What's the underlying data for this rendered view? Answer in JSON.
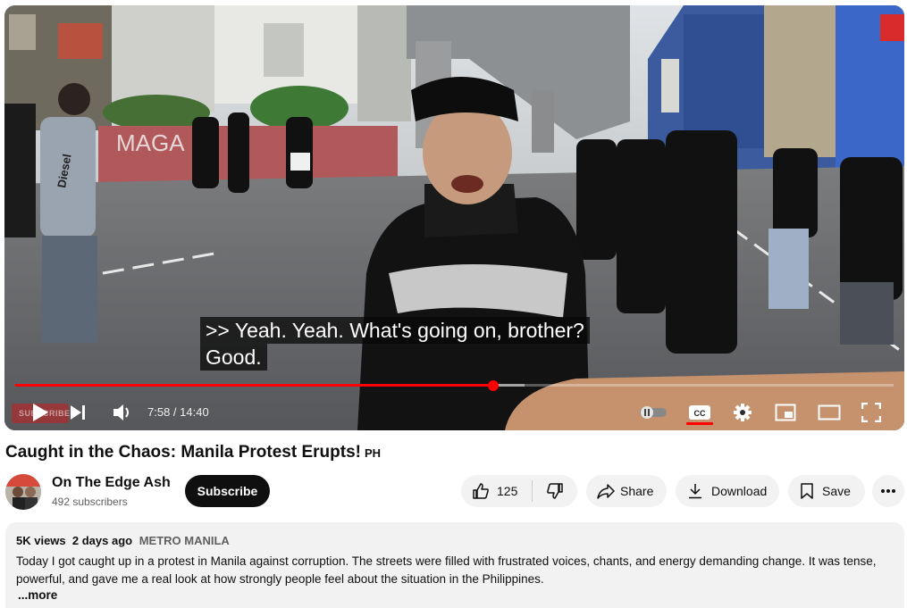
{
  "video": {
    "captions": [
      ">> Yeah. Yeah. What's going on, brother?",
      "Good."
    ],
    "current_time": "7:58",
    "duration": "14:40",
    "time_display": "7:58 / 14:40",
    "progress_fraction": 0.544,
    "buffered_fraction": 0.58,
    "subscribe_watermark": "SUBSCRIBE",
    "wall_graffiti": "MAGA",
    "shirt_print": "Diesel",
    "accent_color": "#ff0000"
  },
  "controls": {
    "icons": [
      "play-icon",
      "next-icon",
      "volume-icon",
      "autoplay-toggle-icon",
      "cc-icon",
      "settings-gear-icon",
      "miniplayer-icon",
      "theater-mode-icon",
      "fullscreen-icon"
    ]
  },
  "video_title": "Caught in the Chaos: Manila Protest Erupts!",
  "title_flag": "PH",
  "channel": {
    "name": "On The Edge Ash",
    "subscribers": "492 subscribers",
    "subscribe_label": "Subscribe"
  },
  "actions": {
    "like_count": "125",
    "share_label": "Share",
    "download_label": "Download",
    "save_label": "Save"
  },
  "description": {
    "views": "5K views",
    "date": "2 days ago",
    "location": "METRO MANILA",
    "text": "Today I got caught up in a protest in Manila against corruption. The streets were filled with frustrated voices, chants, and energy demanding change. It was tense, powerful, and gave me a real look at how strongly people feel about the situation in the Philippines.",
    "more_label": "...more"
  }
}
